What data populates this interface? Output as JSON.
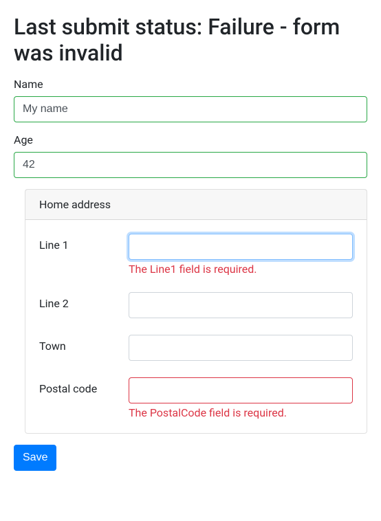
{
  "heading": "Last submit status: Failure - form was invalid",
  "name": {
    "label": "Name",
    "value": "My name"
  },
  "age": {
    "label": "Age",
    "value": "42"
  },
  "address": {
    "header": "Home address",
    "line1": {
      "label": "Line 1",
      "value": "",
      "error": "The Line1 field is required."
    },
    "line2": {
      "label": "Line 2",
      "value": ""
    },
    "town": {
      "label": "Town",
      "value": ""
    },
    "postal": {
      "label": "Postal code",
      "value": "",
      "error": "The PostalCode field is required."
    }
  },
  "saveButton": "Save"
}
